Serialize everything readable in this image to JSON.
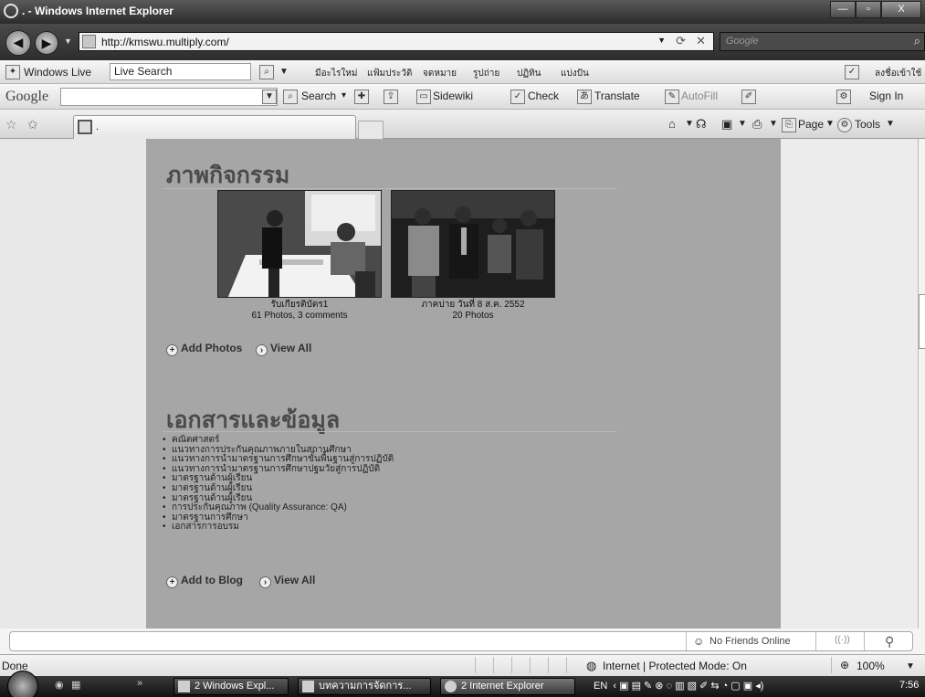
{
  "window": {
    "title": ". - Windows Internet Explorer",
    "controls": {
      "minimize": "—",
      "maximize": "▫",
      "close": "X"
    }
  },
  "address": {
    "url": "http://kmswu.multiply.com/",
    "search_placeholder": "Google"
  },
  "live_toolbar": {
    "brand": "Windows Live",
    "search_value": "Live Search",
    "items": [
      "มีอะไรใหม่",
      "แฟ้มประวัติ",
      "จดหมาย",
      "รูปถ่าย",
      "ปฏิทิน",
      "แบ่งปัน"
    ],
    "signin": "ลงชื่อเข้าใช้"
  },
  "google_toolbar": {
    "logo": "Google",
    "search": "Search",
    "sidewiki": "Sidewiki",
    "check": "Check",
    "translate": "Translate",
    "autofill": "AutoFill",
    "signin": "Sign In"
  },
  "command_bar": {
    "tab_title": ".",
    "page": "Page",
    "tools": "Tools"
  },
  "page": {
    "activities": {
      "title": "ภาพกิจกรรม",
      "albums": [
        {
          "title": "รับเกียรติบัตร1",
          "meta": "61 Photos, 3 comments"
        },
        {
          "title": "ภาคบ่าย วันที่ 8 ส.ค. 2552",
          "meta": "20 Photos"
        }
      ],
      "add_label": "Add Photos",
      "view_label": "View All"
    },
    "documents": {
      "title": "เอกสารและข้อมูล",
      "items": [
        "คณิตศาสตร์",
        "แนวทางการประกันคุณภาพภายในสถานศึกษา",
        "แนวทางการนำมาตรฐานการศึกษาขั้นพื้นฐานสู่การปฏิบัติ",
        "แนวทางการนำมาตรฐานการศึกษาปฐมวัยสู่การปฏิบัติ",
        "มาตรฐานด้านผู้เรียน",
        "มาตรฐานด้านผู้เรียน",
        "มาตรฐานด้านผู้เรียน",
        "การประกันคุณภาพ (Quality Assurance: QA)",
        "มาตรฐานการศึกษา",
        "เอกสารการอบรม"
      ],
      "add_label": "Add to Blog",
      "view_label": "View All"
    }
  },
  "friends_bar": {
    "label": "No Friends Online"
  },
  "status": {
    "left": "Done",
    "zone": "Internet | Protected Mode: On",
    "zoom": "100%"
  },
  "taskbar": {
    "buttons": [
      "2 Windows Expl...",
      "บทความการจัดการ...",
      "2 Internet Explorer"
    ],
    "lang": "EN",
    "clock": "7:56"
  }
}
